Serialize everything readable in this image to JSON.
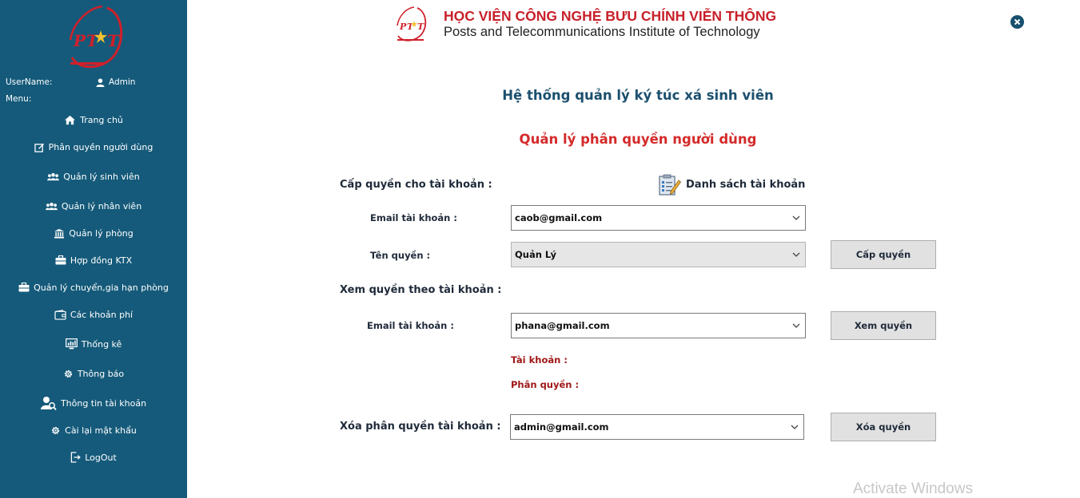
{
  "sidebar": {
    "username_label": "UserName:",
    "username": "Admin",
    "menu_label": "Menu:",
    "items": [
      {
        "label": "Trang chủ",
        "icon": "home-icon"
      },
      {
        "label": "Phân quyền người dùng",
        "icon": "edit-icon"
      },
      {
        "label": "Quản lý sinh viên",
        "icon": "users-icon"
      },
      {
        "label": "Quản lý nhân viên",
        "icon": "users-icon"
      },
      {
        "label": "Quản lý phòng",
        "icon": "institution-icon"
      },
      {
        "label": "Hợp đồng KTX",
        "icon": "briefcase-icon"
      },
      {
        "label": "Quản lý chuyển,gia hạn phòng",
        "icon": "briefcase-icon"
      },
      {
        "label": "Các khoản phí",
        "icon": "wallet-icon"
      },
      {
        "label": "Thống kê",
        "icon": "monitor-chart-icon"
      },
      {
        "label": "Thông báo",
        "icon": "gear-icon"
      },
      {
        "label": "Thông tin tài khoản",
        "icon": "user-search-icon"
      },
      {
        "label": "Cài lại mật khẩu",
        "icon": "gear-icon"
      },
      {
        "label": "LogOut",
        "icon": "logout-icon"
      }
    ]
  },
  "header": {
    "brand_vn": "HỌC VIỆN CÔNG NGHỆ BƯU CHÍNH VIỄN THÔNG",
    "brand_en": "Posts and Telecommunications Institute of Technology",
    "logo_text": "PTIT"
  },
  "main": {
    "system_title": "Hệ thống quản lý ký túc xá sinh viên",
    "page_title": "Quản lý phân quyền người dùng",
    "grant": {
      "section_label": "Cấp quyền cho tài khoản :",
      "list_link": "Danh sách tài khoản",
      "email_label": "Email tài khoản :",
      "email_value": "caob@gmail.com",
      "role_label": "Tên quyền :",
      "role_value": "Quản Lý",
      "button": "Cấp quyền"
    },
    "view": {
      "section_label": "Xem quyền theo tài khoản :",
      "email_label": "Email tài khoản :",
      "email_value": "phana@gmail.com",
      "button": "Xem quyền",
      "account_label": "Tài khoản :",
      "role_label": "Phân quyền :"
    },
    "delete": {
      "section_label": "Xóa phân quyền tài khoản :",
      "email_value": "admin@gmail.com",
      "button": "Xóa quyền"
    }
  },
  "watermark": "Activate Windows",
  "colors": {
    "sidebar_bg": "#155a7a",
    "title_blue": "#1b4f6e",
    "title_red": "#d42a2a",
    "info_red": "#a01818"
  }
}
